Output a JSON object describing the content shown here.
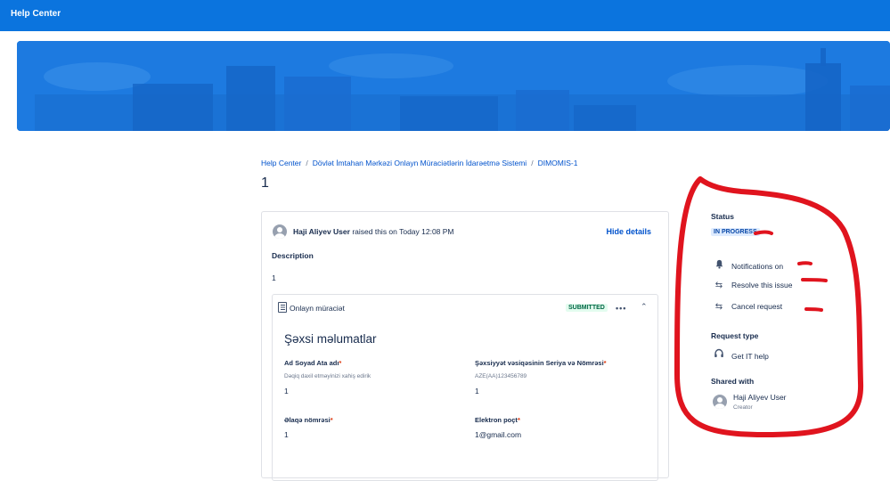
{
  "topbar": {
    "brand": "Help Center"
  },
  "breadcrumb": {
    "items": [
      "Help Center",
      "Dövlət İmtahan Mərkəzi Onlayn Müraciətlərin İdarəetmə Sistemi",
      "DIMOMIS-1"
    ]
  },
  "page": {
    "title": "1"
  },
  "request": {
    "reporter": "Haji Aliyev User",
    "raised_text": "raised this on Today 12:08 PM",
    "hide_details": "Hide details",
    "description_label": "Description",
    "description_value": "1"
  },
  "form": {
    "name": "Onlayn müraciət",
    "status": "SUBMITTED",
    "section_title": "Şəxsi məlumatlar",
    "fields": [
      {
        "label": "Ad  Soyad Ata adı",
        "required": "*",
        "help": "Dəqiq daxil etməyinizi xahiş edirik",
        "value": "1"
      },
      {
        "label": "Şəxsiyyət vəsiqəsinin Seriya və Nömrəsi",
        "required": "*",
        "help": "AZE(AA)123456789",
        "value": "1"
      },
      {
        "label": "Əlaqə nömrəsi",
        "required": "*",
        "help": "",
        "value": "1"
      },
      {
        "label": "Elektron poçt",
        "required": "*",
        "help": "",
        "value": "1@gmail.com"
      }
    ]
  },
  "sidebar": {
    "status_label": "Status",
    "status_value": "IN PROGRESS",
    "actions": [
      {
        "label": "Notifications on",
        "icon": "bell-icon"
      },
      {
        "label": "Resolve this issue",
        "icon": "transition-icon"
      },
      {
        "label": "Cancel request",
        "icon": "transition-icon"
      }
    ],
    "request_type_label": "Request type",
    "request_type_value": "Get IT help",
    "shared_label": "Shared with",
    "shared_name": "Haji Aliyev User",
    "shared_role": "Creator"
  },
  "colors": {
    "topbar": "#0b74de",
    "banner": "#1d7ae0",
    "link": "#0052cc",
    "annotation": "#e0141e"
  }
}
